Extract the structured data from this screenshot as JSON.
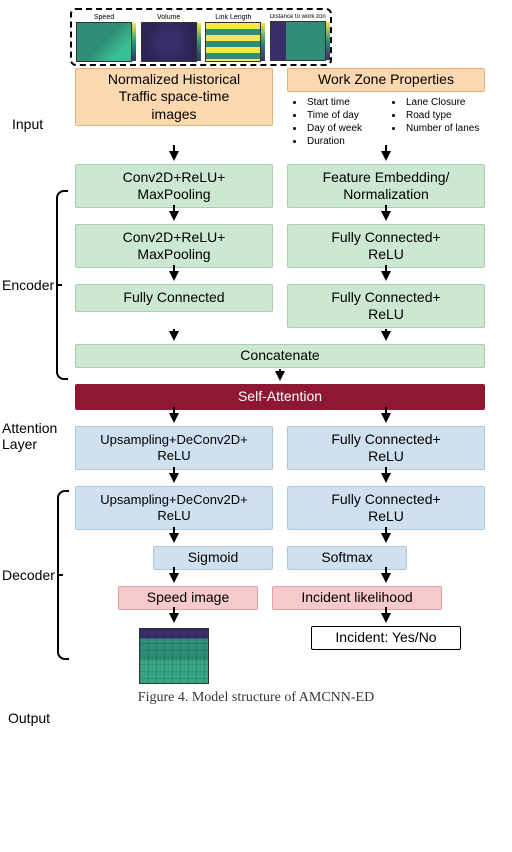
{
  "stage_labels": {
    "input": "Input",
    "encoder": "Encoder",
    "attention": "Attention\nLayer",
    "decoder": "Decoder",
    "output": "Output"
  },
  "thumbs": [
    "Speed",
    "Volume",
    "Link Length",
    "Distance to work\nzone"
  ],
  "input_left": "Normalized Historical\nTraffic space-time\nimages",
  "input_right_title": "Work Zone Properties",
  "work_zone_props": [
    "Start time",
    "Lane Closure",
    "Time of day",
    "Road type",
    "Day of week",
    "Number of lanes",
    "Duration"
  ],
  "encoder": {
    "l1": "Conv2D+ReLU+\nMaxPooling",
    "l2": "Conv2D+ReLU+\nMaxPooling",
    "l3": "Fully Connected",
    "r1": "Feature Embedding/\nNormalization",
    "r2": "Fully Connected+\nReLU",
    "r3": "Fully Connected+\nReLU",
    "concat": "Concatenate"
  },
  "attention": "Self-Attention",
  "decoder": {
    "l1": "Upsampling+DeConv2D+\nReLU",
    "l2": "Upsampling+DeConv2D+\nReLU",
    "l3": "Sigmoid",
    "r1": "Fully Connected+\nReLU",
    "r2": "Fully Connected+\nReLU",
    "r3": "Softmax"
  },
  "output": {
    "left": "Speed image",
    "right": "Incident likelihood",
    "verdict": "Incident: Yes/No"
  },
  "caption": "Figure 4. Model structure of AMCNN-ED"
}
